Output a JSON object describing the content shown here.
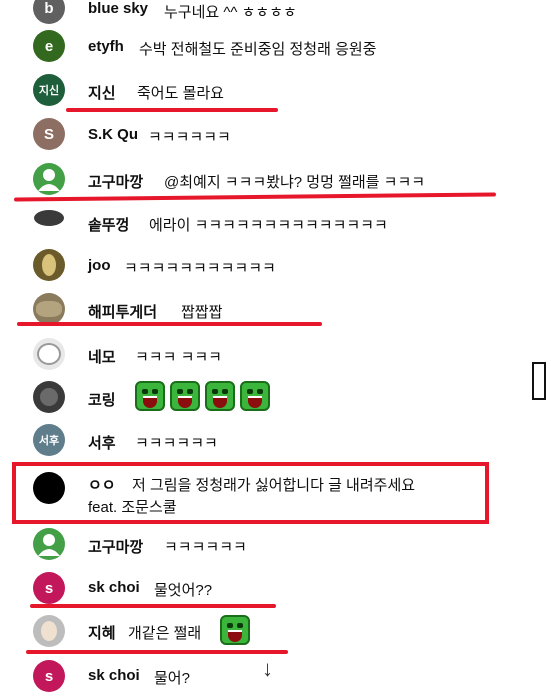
{
  "comments": [
    {
      "name": "blue sky",
      "message": "누구네요 ^^ ㅎㅎㅎㅎ",
      "avatar_letter": "b",
      "avatar_color": "#606060"
    },
    {
      "name": "etyfh",
      "message": "수박 전해철도 준비중임 정청래 응원중",
      "avatar_letter": "e",
      "avatar_color": "#33691e"
    },
    {
      "name": "지신",
      "message": "죽어도 몰라요",
      "avatar_letter": "지신",
      "avatar_color": "#1e5e3a"
    },
    {
      "name": "S.K Qu",
      "message": "ㅋㅋㅋㅋㅋㅋ",
      "avatar_letter": "S",
      "avatar_color": "#8d6e63"
    },
    {
      "name": "고구마깡",
      "message": "@최예지 ㅋㅋㅋ봤냐? 멍멍 쩔래를 ㅋㅋㅋ",
      "avatar_letter": "",
      "avatar_color": "#43a047"
    },
    {
      "name": "솥뚜껑",
      "message": "에라이 ㅋㅋㅋㅋㅋㅋㅋㅋㅋㅋㅋㅋㅋㅋ",
      "avatar_letter": "",
      "avatar_color": "#d9d9d9"
    },
    {
      "name": "joo",
      "message": "ㅋㅋㅋㅋㅋㅋㅋㅋㅋㅋㅋ",
      "avatar_letter": "",
      "avatar_color": "#6b5a2a"
    },
    {
      "name": "해피투게더",
      "message": "짭짭짭",
      "avatar_letter": "",
      "avatar_color": "#8a7b5c"
    },
    {
      "name": "네모",
      "message": "ㅋㅋㅋ ㅋㅋㅋ",
      "avatar_letter": "",
      "avatar_color": "#e8e8e8"
    },
    {
      "name": "코링",
      "message": "",
      "avatar_letter": "",
      "avatar_color": "#3a3a3a"
    },
    {
      "name": "서후",
      "message": "ㅋㅋㅋㅋㅋㅋ",
      "avatar_letter": "서후",
      "avatar_color": "#5f7d8a"
    },
    {
      "name": "ㅇㅇ",
      "message": "저 그림을 정청래가 싫어합니다 글 내려주세요",
      "message2": "feat. 조문스쿨",
      "avatar_letter": "",
      "avatar_color": "#000000"
    },
    {
      "name": "고구마깡",
      "message": "ㅋㅋㅋㅋㅋㅋ",
      "avatar_letter": "",
      "avatar_color": "#43a047"
    },
    {
      "name": "sk choi",
      "message": "물엇어??",
      "avatar_letter": "s",
      "avatar_color": "#c2185b"
    },
    {
      "name": "지혜",
      "message": "개같은 쩔래",
      "avatar_letter": "",
      "avatar_color": "#bdbdbd"
    },
    {
      "name": "sk choi",
      "message": "물어?",
      "avatar_letter": "s",
      "avatar_color": "#c2185b"
    }
  ],
  "scroll_down_glyph": "↓",
  "side_glyph": "▯"
}
